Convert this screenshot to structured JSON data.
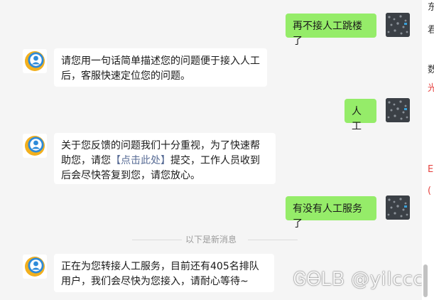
{
  "messages": [
    {
      "side": "out",
      "text": "再不接人工跳楼了"
    },
    {
      "side": "in",
      "text": "请您用一句话简单描述您的问题便于接入人工后，客服快速定位您的问题。"
    },
    {
      "side": "out",
      "text": "人工"
    },
    {
      "side": "in",
      "text_before": "关于您反馈的问题我们十分重视，为了快速帮助您，请您",
      "link": "【点击此处】",
      "text_after": "提交，工作人员收到后会尽快答复到您，请您放心。"
    },
    {
      "side": "out",
      "text": "有没有人工服务了"
    },
    {
      "side": "in",
      "text": "正在为您转接人工服务，目前还有405名排队用户，我们会尽快为您接入，请耐心等待~"
    }
  ],
  "divider": {
    "text": "以下是新消息"
  },
  "watermark": {
    "text": "ᎶᎾᏞᏴ @yilccca"
  },
  "right_edge_chars": [
    {
      "text": "东",
      "color": "dark"
    },
    {
      "text": "君",
      "color": "dark"
    },
    {
      "text": "数",
      "color": "dark"
    },
    {
      "text": "光",
      "color": "red"
    },
    {
      "text": "E",
      "color": "red"
    },
    {
      "text": "(",
      "color": "red"
    }
  ],
  "avatars": {
    "bot": "customer-service-bot-avatar",
    "user": "user-photo-avatar"
  }
}
